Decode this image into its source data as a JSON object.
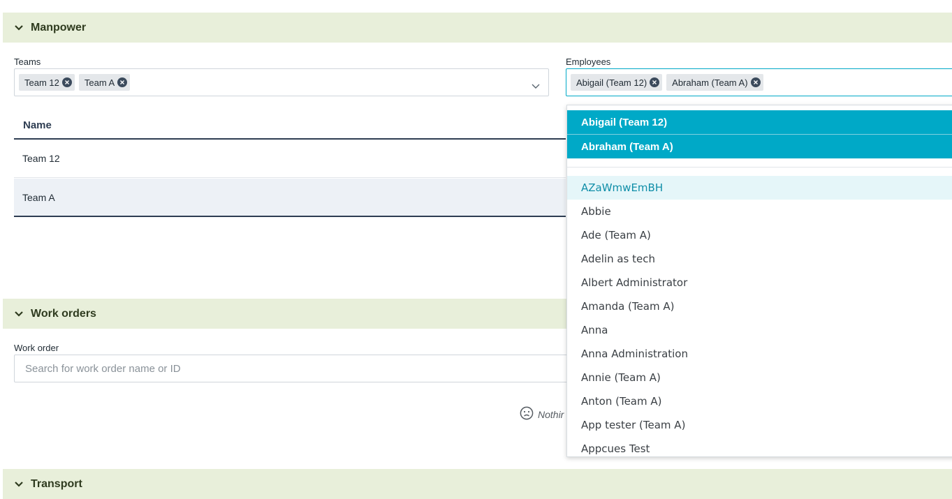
{
  "sections": {
    "manpower": "Manpower",
    "work_orders": "Work orders",
    "transport": "Transport"
  },
  "teams": {
    "label": "Teams",
    "chips": [
      "Team 12",
      "Team A"
    ]
  },
  "employees": {
    "label": "Employees",
    "chips": [
      "Abigail (Team 12)",
      "Abraham (Team A)"
    ]
  },
  "table": {
    "header": "Name",
    "rows": [
      "Team 12",
      "Team A"
    ]
  },
  "work_order": {
    "label": "Work order",
    "placeholder": "Search for work order name or ID",
    "empty_text": "Nothir"
  },
  "dropdown": {
    "selected": [
      "Abigail (Team 12)",
      "Abraham (Team A)"
    ],
    "options": [
      "AZaWmwEmBH",
      "Abbie",
      "Ade (Team A)",
      "Adelin as tech",
      "Albert Administrator",
      "Amanda (Team A)",
      "Anna",
      "Anna Administration",
      "Annie (Team A)",
      "Anton (Team A)",
      "App tester (Team A)",
      "Appcues Test"
    ]
  },
  "colors": {
    "section_bg": "#e8efda",
    "accent": "#00a9c7",
    "highlight": "#e5f6f9",
    "row_selected": "#edf1f6"
  }
}
